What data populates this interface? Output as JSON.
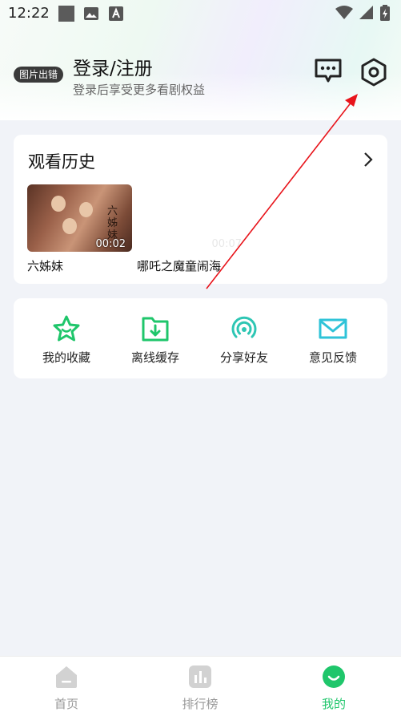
{
  "status_bar": {
    "time": "12:22",
    "icons": [
      "square-notification-icon",
      "image-icon",
      "a-icon",
      "wifi-icon",
      "signal-icon",
      "battery-icon"
    ]
  },
  "profile": {
    "avatar_text": "图片出错",
    "login_title": "登录/注册",
    "login_subtitle": "登录后享受更多看剧权益",
    "icons": [
      "message-icon",
      "settings-icon"
    ]
  },
  "history": {
    "title": "观看历史",
    "items": [
      {
        "title": "六姊妹",
        "duration": "00:02",
        "poster_text": "六姊妹"
      },
      {
        "title": "哪吒之魔童闹海",
        "duration": "00:07"
      }
    ]
  },
  "tools": [
    {
      "label": "我的收藏",
      "icon": "star-icon"
    },
    {
      "label": "离线缓存",
      "icon": "download-folder-icon"
    },
    {
      "label": "分享好友",
      "icon": "share-signal-icon"
    },
    {
      "label": "意见反馈",
      "icon": "mail-icon"
    }
  ],
  "tabbar": {
    "tabs": [
      {
        "label": "首页",
        "icon": "home-icon",
        "active": false
      },
      {
        "label": "排行榜",
        "icon": "ranking-icon",
        "active": false
      },
      {
        "label": "我的",
        "icon": "mine-icon",
        "active": true
      }
    ]
  },
  "colors": {
    "accent": "#1fc66b",
    "annotation_arrow": "#e8141b",
    "background": "#f1f3f8"
  }
}
